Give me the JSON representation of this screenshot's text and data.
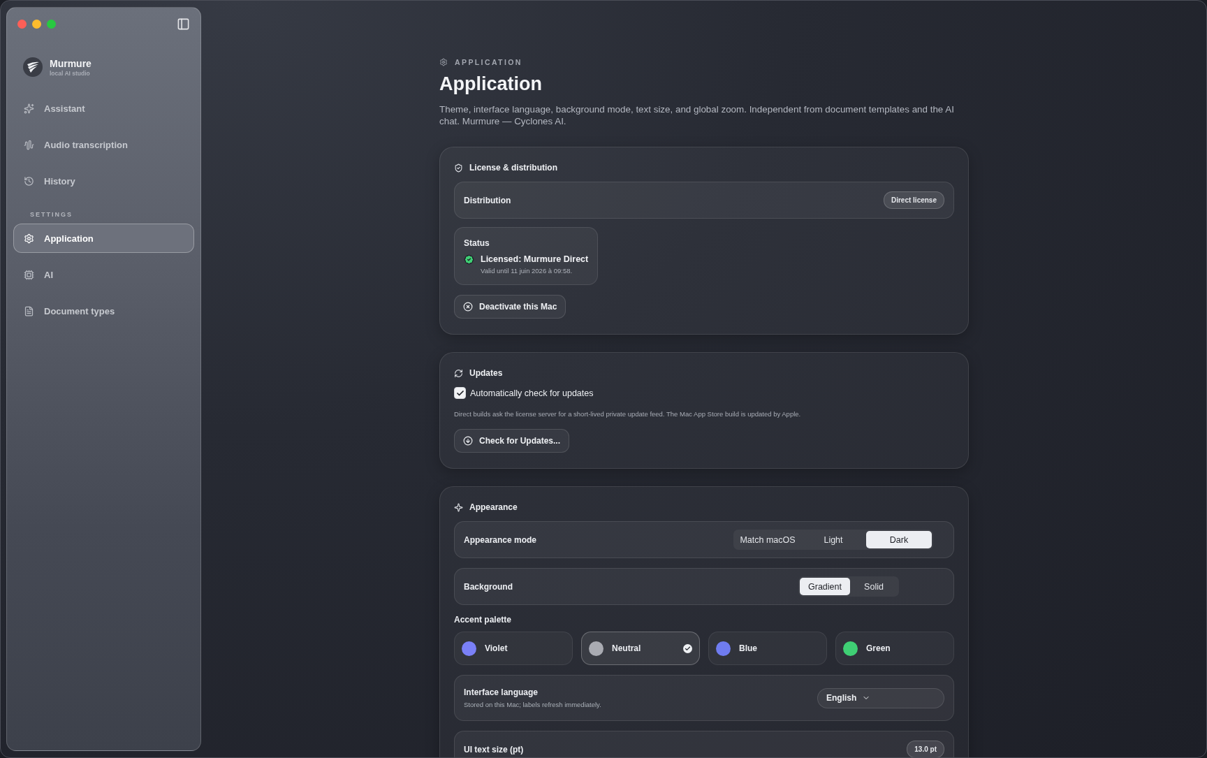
{
  "sidebar": {
    "app_name": "Murmure",
    "app_subtitle": "local AI studio",
    "items": [
      {
        "label": "Assistant",
        "selected": false
      },
      {
        "label": "Audio transcription",
        "selected": false
      },
      {
        "label": "History",
        "selected": false
      }
    ],
    "section_label": "SETTINGS",
    "settings_items": [
      {
        "label": "Application",
        "selected": true
      },
      {
        "label": "AI",
        "selected": false
      },
      {
        "label": "Document types",
        "selected": false
      }
    ]
  },
  "breadcrumb": "APPLICATION",
  "title": "Application",
  "description": "Theme, interface language, background mode, text size, and global zoom. Independent from document templates and the AI chat. Murmure — Cyclones AI.",
  "license": {
    "title": "License & distribution",
    "distribution_label": "Distribution",
    "distribution_badge": "Direct license",
    "status_label": "Status",
    "status_text": "Licensed: Murmure Direct",
    "status_detail": "Valid until 11 juin 2026 à 09:58.",
    "deactivate_button": "Deactivate this Mac"
  },
  "updates": {
    "title": "Updates",
    "auto_check": {
      "label": "Automatically check for updates",
      "checked": true
    },
    "note": "Direct builds ask the license server for a short-lived private update feed. The Mac App Store build is updated by Apple.",
    "check_button": "Check for Updates..."
  },
  "appearance": {
    "title": "Appearance",
    "mode": {
      "label": "Appearance mode",
      "options": [
        {
          "label": "Match macOS",
          "selected": false
        },
        {
          "label": "Light",
          "selected": false
        },
        {
          "label": "Dark",
          "selected": true
        }
      ]
    },
    "background": {
      "label": "Background",
      "options": [
        {
          "label": "Gradient",
          "selected": true
        },
        {
          "label": "Solid",
          "selected": false
        }
      ]
    },
    "accent_label": "Accent palette",
    "accents": [
      {
        "label": "Violet",
        "color": "#7a80f7",
        "selected": false
      },
      {
        "label": "Neutral",
        "color": "#a9abb2",
        "selected": true
      },
      {
        "label": "Blue",
        "color": "#6f7cf0",
        "selected": false
      },
      {
        "label": "Green",
        "color": "#3fcf74",
        "selected": false
      }
    ],
    "language": {
      "label": "Interface language",
      "hint": "Stored on this Mac; labels refresh immediately.",
      "value": "English"
    },
    "text_size": {
      "label": "UI text size (pt)",
      "value": "13.0 pt"
    }
  }
}
